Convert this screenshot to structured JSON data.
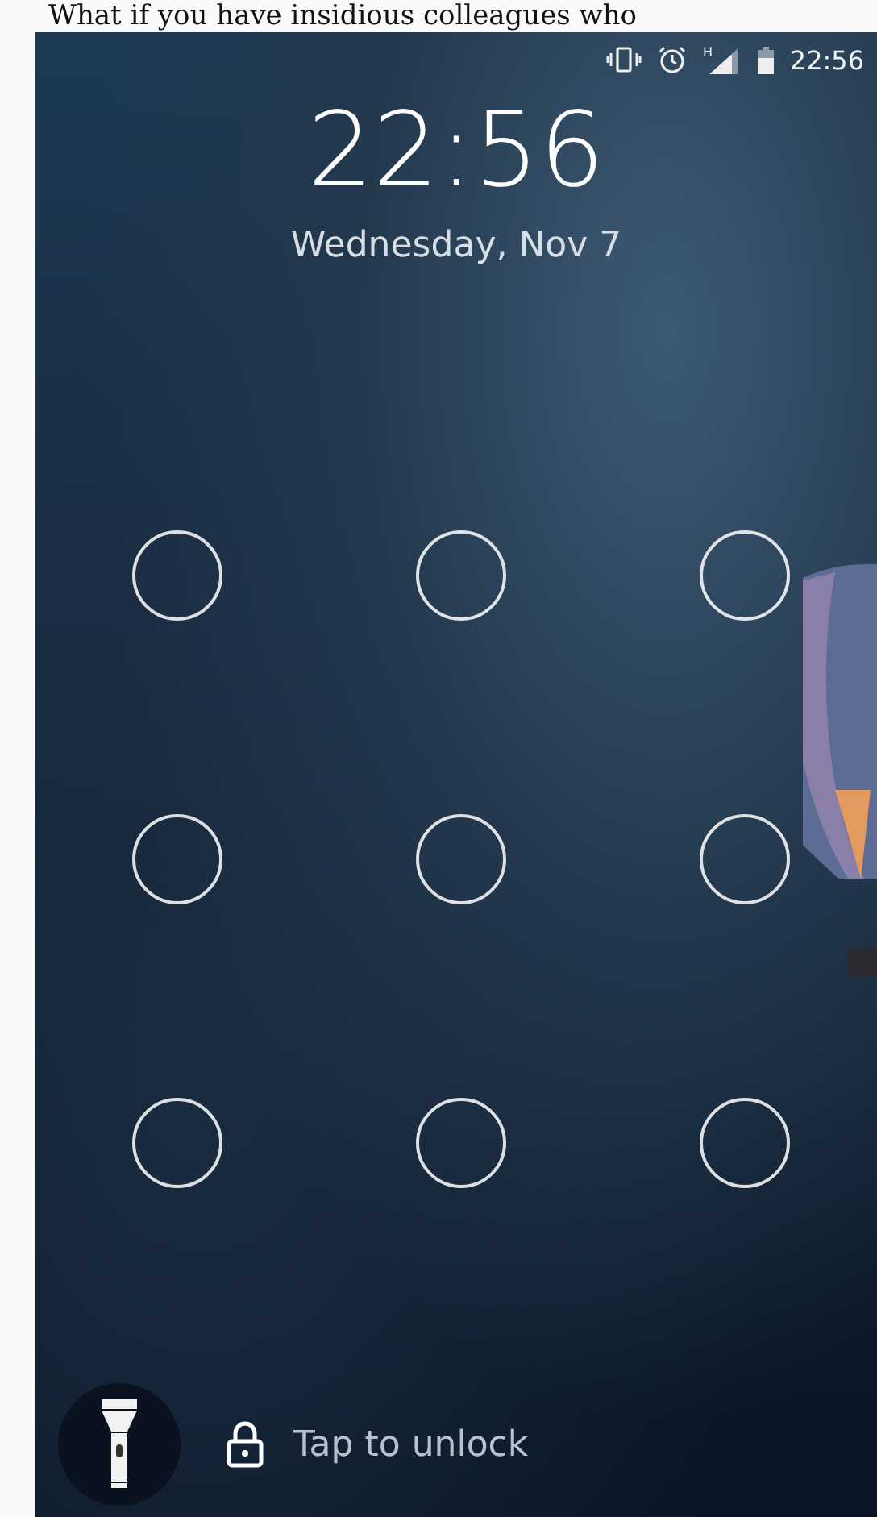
{
  "caption": "What if you have insidious colleagues who",
  "status_bar": {
    "time": "22:56",
    "network": "H"
  },
  "clock": {
    "time": "22:56",
    "date": "Wednesday, Nov 7"
  },
  "unlock_hint": "Tap to unlock"
}
